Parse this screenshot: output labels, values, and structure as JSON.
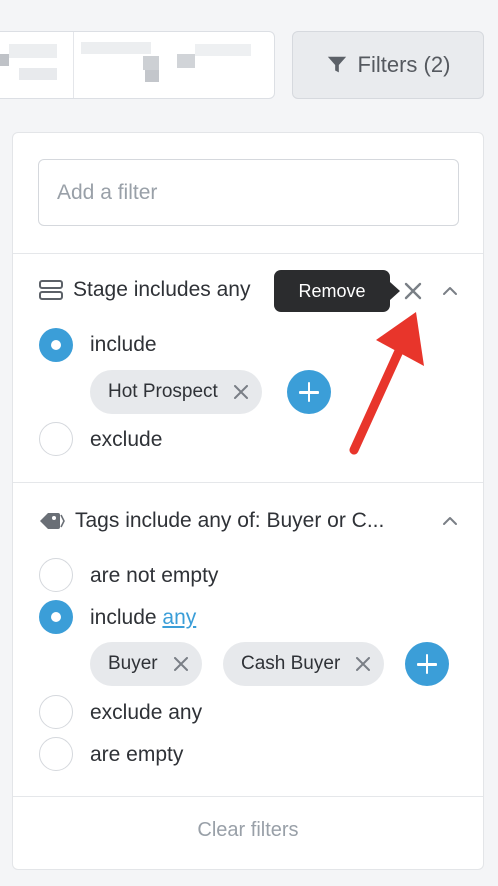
{
  "top": {
    "filters_button_label": "Filters (2)"
  },
  "panel": {
    "add_filter_placeholder": "Add a filter",
    "stage_filter": {
      "title": "Stage includes any",
      "options": [
        {
          "label": "include",
          "selected": true
        },
        {
          "label": "exclude",
          "selected": false
        }
      ],
      "chips": [
        "Hot Prospect"
      ]
    },
    "tags_filter": {
      "title": "Tags include any of: Buyer or C...",
      "options": [
        {
          "label": "are not empty",
          "selected": false
        },
        {
          "label": "include",
          "link": "any",
          "selected": true
        },
        {
          "label": "exclude any",
          "selected": false
        },
        {
          "label": "are empty",
          "selected": false
        }
      ],
      "chips": [
        "Buyer",
        "Cash Buyer"
      ]
    },
    "clear_label": "Clear filters"
  },
  "tooltip": {
    "text": "Remove"
  },
  "colors": {
    "accent": "#3b9ed8",
    "annotation_arrow": "#e8352b"
  }
}
